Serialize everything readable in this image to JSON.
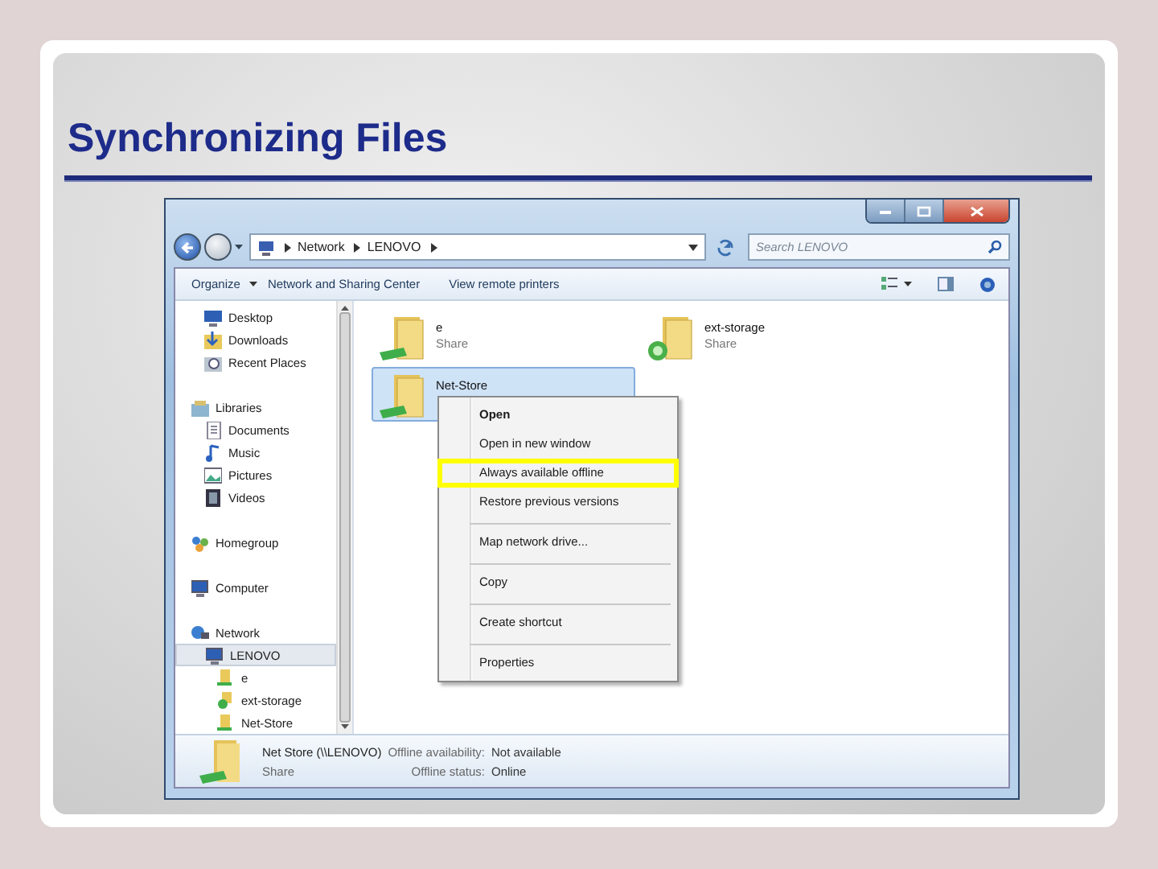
{
  "slide_title": "Synchronizing Files",
  "window": {
    "address": {
      "crumbs": [
        "Network",
        "LENOVO"
      ]
    },
    "search": {
      "placeholder": "Search LENOVO"
    },
    "toolbar": {
      "organize": "Organize",
      "buttons": [
        "Network and Sharing Center",
        "View remote printers"
      ]
    },
    "nav_groups": [
      {
        "children": [
          {
            "label": "Desktop",
            "kind": "desktop",
            "selected": false
          },
          {
            "label": "Downloads",
            "kind": "downloads",
            "selected": false
          },
          {
            "label": "Recent Places",
            "kind": "recent",
            "selected": false
          }
        ]
      },
      {
        "label": "Libraries",
        "kind": "library",
        "selected": false,
        "children": [
          {
            "label": "Documents",
            "kind": "documents",
            "selected": false
          },
          {
            "label": "Music",
            "kind": "music",
            "selected": false
          },
          {
            "label": "Pictures",
            "kind": "pictures",
            "selected": false
          },
          {
            "label": "Videos",
            "kind": "videos",
            "selected": false
          }
        ]
      },
      {
        "label": "Homegroup",
        "kind": "homegroup",
        "selected": false
      },
      {
        "label": "Computer",
        "kind": "computer",
        "selected": false
      },
      {
        "label": "Network",
        "kind": "network",
        "selected": false,
        "children": [
          {
            "label": "LENOVO",
            "kind": "computer",
            "selected": true,
            "children": [
              {
                "label": "e",
                "kind": "share",
                "selected": false
              },
              {
                "label": "ext-storage",
                "kind": "synced-share",
                "selected": false
              },
              {
                "label": "Net-Store",
                "kind": "share",
                "selected": false
              }
            ]
          }
        ]
      }
    ],
    "items": [
      {
        "name": "e",
        "type": "Share",
        "kind": "share",
        "selected": false
      },
      {
        "name": "ext-storage",
        "type": "Share",
        "kind": "synced-share",
        "selected": false
      },
      {
        "name": "Net-Store",
        "kind": "share",
        "selected": true
      }
    ],
    "context_menu": [
      {
        "label": "Open",
        "default": true,
        "highlighted": false,
        "divider_above": false
      },
      {
        "label": "Open in new window",
        "default": false,
        "highlighted": false,
        "divider_above": false
      },
      {
        "label": "Always available offline",
        "default": false,
        "highlighted": true,
        "divider_above": false
      },
      {
        "label": "Restore previous versions",
        "default": false,
        "highlighted": false,
        "divider_above": false
      },
      {
        "label": "Map network drive...",
        "default": false,
        "highlighted": false,
        "divider_above": true
      },
      {
        "label": "Copy",
        "default": false,
        "highlighted": false,
        "divider_above": true
      },
      {
        "label": "Create shortcut",
        "default": false,
        "highlighted": false,
        "divider_above": true
      },
      {
        "label": "Properties",
        "default": false,
        "highlighted": false,
        "divider_above": true
      }
    ],
    "details": {
      "name": "Net Store (\\\\LENOVO)",
      "type": "Share",
      "fields": [
        {
          "label": "Offline availability:",
          "value": "Not available"
        },
        {
          "label": "Offline status:",
          "value": "Online"
        }
      ]
    }
  }
}
